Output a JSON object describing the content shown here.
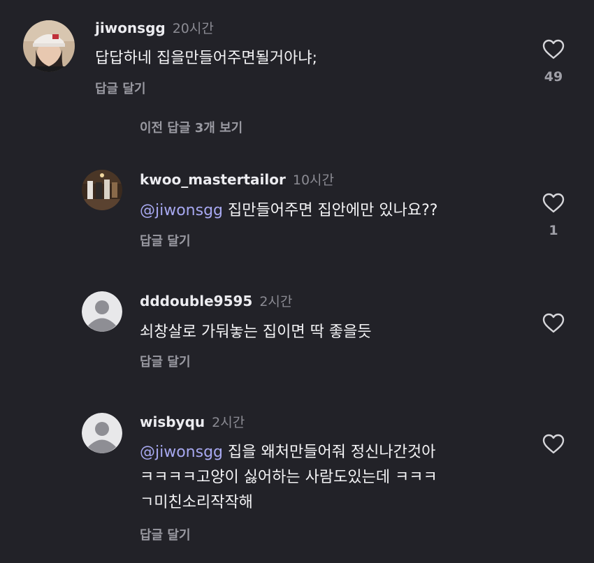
{
  "comments": [
    {
      "username": "jiwonsgg",
      "time": "20시간",
      "text": "답답하네 집을만들어주면될거아냐;",
      "reply": "답글 달기",
      "likes": "49"
    }
  ],
  "view_previous": "이전 답글 3개 보기",
  "replies": [
    {
      "username": "kwoo_mastertailor",
      "time": "10시간",
      "mention": "@jiwonsgg",
      "text": " 집만들어주면 집안에만 있나요??",
      "reply": "답글 달기",
      "likes": "1"
    },
    {
      "username": "dddouble9595",
      "time": "2시간",
      "text": "쇠창살로 가둬놓는 집이면 딱 좋을듯",
      "reply": "답글 달기"
    },
    {
      "username": "wisbyqu",
      "time": "2시간",
      "mention": "@jiwonsgg",
      "text_line1": " 집을 왜처만들어줘 정신나간것아",
      "text_line2": "ㅋㅋㅋㅋ고양이 싫어하는 사람도있는데 ㅋㅋㅋ",
      "text_line3": "ㄱ미친소리작작해",
      "reply": "답글 달기"
    }
  ]
}
